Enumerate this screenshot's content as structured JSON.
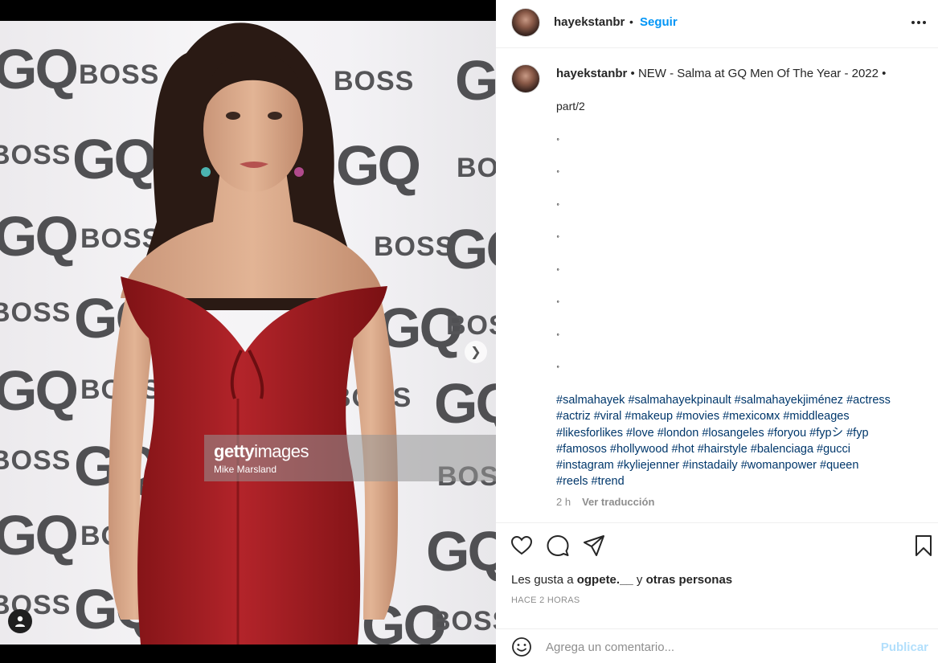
{
  "media": {
    "watermark_gq": "GQ",
    "watermark_boss": "BOSS",
    "getty_brand_bold": "getty",
    "getty_brand_light": "images",
    "getty_credit": "Mike Marsland",
    "carousel": {
      "count": 3,
      "active": 1
    }
  },
  "header": {
    "username": "hayekstanbr",
    "separator": "•",
    "follow_label": "Seguir",
    "more_icon": "more-horizontal-icon"
  },
  "caption": {
    "username": "hayekstanbr",
    "text": " • NEW - Salma at GQ Men Of The Year - 2022 •",
    "part": "part/2",
    "spacer_glyph": "˳",
    "hashtags_lines": [
      "#salmahayek #salmahayekpinault #salmahayekjiménez #actress",
      "#actriz #viral #makeup #movies #mexicoмх #middleages",
      "#likesforlikes #love #london #losangeles #foryou #fypシ #fyp",
      "#famosos #hollywood #hot #hairstyle #balenciaga #gucci",
      "#instagram #kyliejenner #instadaily #womanpower #queen",
      "#reels #trend"
    ],
    "time": "2 h",
    "translate_label": "Ver traducción"
  },
  "actions": {
    "icons": [
      "heart-icon",
      "comment-icon",
      "share-icon",
      "bookmark-icon"
    ]
  },
  "likes": {
    "prefix": "Les gusta a ",
    "user": "ogpete.__",
    "middle": " y ",
    "others": "otras personas"
  },
  "timestamp": "HACE 2 HORAS",
  "comment_box": {
    "placeholder": "Agrega un comentario...",
    "publish_label": "Publicar"
  },
  "colors": {
    "link_blue": "#0095f6",
    "hashtag_blue": "#00376b",
    "publish_disabled": "#b2dffc",
    "dress_red": "#9e1a1c"
  }
}
